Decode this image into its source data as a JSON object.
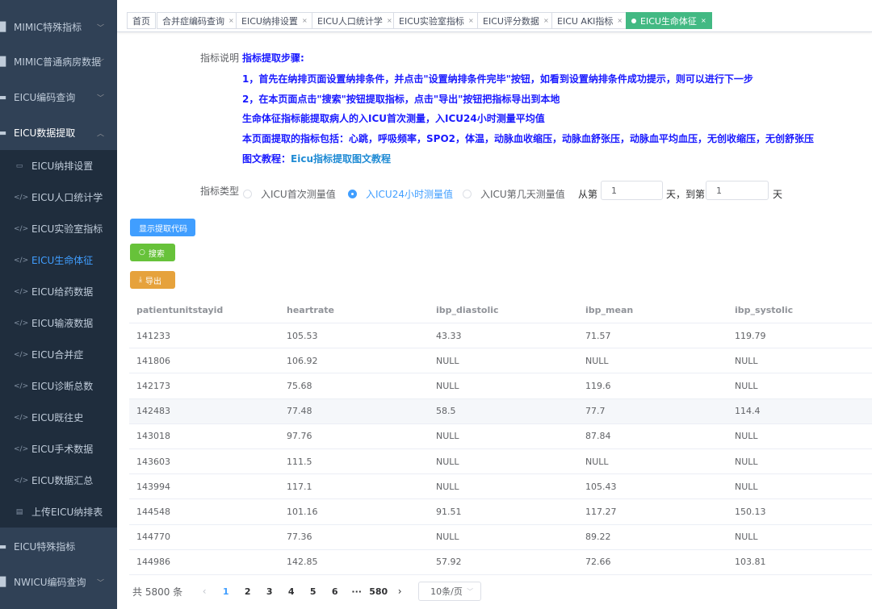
{
  "sidebar": {
    "menus": [
      {
        "label": "MIMIC特殊指标",
        "icon": "bar-chart-icon"
      },
      {
        "label": "MIMIC普通病房数据",
        "icon": "bar-chart-icon"
      },
      {
        "label": "EICU编码查询",
        "icon": "folder-icon"
      },
      {
        "label": "EICU数据提取",
        "icon": "folder-icon"
      }
    ],
    "sub_items": [
      {
        "label": "EICU纳排设置",
        "icon": "monitor-icon"
      },
      {
        "label": "EICU人口统计学",
        "icon": "code-icon"
      },
      {
        "label": "EICU实验室指标",
        "icon": "code-icon"
      },
      {
        "label": "EICU生命体征",
        "icon": "code-icon"
      },
      {
        "label": "EICU给药数据",
        "icon": "code-icon"
      },
      {
        "label": "EICU输液数据",
        "icon": "code-icon"
      },
      {
        "label": "EICU合并症",
        "icon": "code-icon"
      },
      {
        "label": "EICU诊断总数",
        "icon": "code-icon"
      },
      {
        "label": "EICU既往史",
        "icon": "code-icon"
      },
      {
        "label": "EICU手术数据",
        "icon": "code-icon"
      },
      {
        "label": "EICU数据汇总",
        "icon": "code-icon"
      },
      {
        "label": "上传EICU纳排表",
        "icon": "table-icon"
      }
    ],
    "bottom_menus": [
      {
        "label": "EICU特殊指标",
        "icon": "folder-icon"
      },
      {
        "label": "NWICU编码查询",
        "icon": "bar-chart-icon"
      }
    ],
    "active_sub": "EICU生命体征"
  },
  "tags": [
    {
      "label": "首页"
    },
    {
      "label": "合并症编码查询"
    },
    {
      "label": "EICU纳排设置"
    },
    {
      "label": "EICU人口统计学"
    },
    {
      "label": "EICU实验室指标"
    },
    {
      "label": "EICU评分数据"
    },
    {
      "label": "EICU AKI指标"
    },
    {
      "label": "EICU生命体征"
    }
  ],
  "description": {
    "label": "指标说明",
    "heading": "指标提取步骤:",
    "step1": "1，首先在纳排页面设置纳排条件，并点击\"设置纳排条件完毕\"按钮，如看到设置纳排条件成功提示，则可以进行下一步",
    "step2": "2，在本页面点击\"搜索\"按钮提取指标，点击\"导出\"按钮把指标导出到本地",
    "note": "生命体征指标能提取病人的入ICU首次测量，入ICU24小时测量平均值",
    "includes": "本页面提取的指标包括：心跳，呼吸频率，SPO2，体温，动脉血收缩压，动脉血舒张压，动脉血平均血压，无创收缩压，无创舒张压",
    "tutorial_prefix": "图文教程：",
    "tutorial_link": "Eicu指标提取图文教程"
  },
  "type_row": {
    "label": "指标类型",
    "options": [
      "入ICU首次测量值",
      "入ICU24小时测量值",
      "入ICU第几天测量值"
    ],
    "selected": "入ICU24小时测量值",
    "from_label": "从第",
    "from_value": "1",
    "day_to_label": "天，到第",
    "to_value": "1",
    "day_label": "天"
  },
  "buttons": {
    "show_code": "显示提取代码",
    "search": "搜索",
    "export": "导出"
  },
  "table": {
    "columns": [
      "patientunitstayid",
      "heartrate",
      "ibp_diastolic",
      "ibp_mean",
      "ibp_systolic"
    ],
    "rows": [
      [
        "141233",
        "105.53",
        "43.33",
        "71.57",
        "119.79"
      ],
      [
        "141806",
        "106.92",
        "NULL",
        "NULL",
        "NULL"
      ],
      [
        "142173",
        "75.68",
        "NULL",
        "119.6",
        "NULL"
      ],
      [
        "142483",
        "77.48",
        "58.5",
        "77.7",
        "114.4"
      ],
      [
        "143018",
        "97.76",
        "NULL",
        "87.84",
        "NULL"
      ],
      [
        "143603",
        "111.5",
        "NULL",
        "NULL",
        "NULL"
      ],
      [
        "143994",
        "117.1",
        "NULL",
        "105.43",
        "NULL"
      ],
      [
        "144548",
        "101.16",
        "91.51",
        "117.27",
        "150.13"
      ],
      [
        "144770",
        "77.36",
        "NULL",
        "89.22",
        "NULL"
      ],
      [
        "144986",
        "142.85",
        "57.92",
        "72.66",
        "103.81"
      ]
    ]
  },
  "pagination": {
    "total": "共 5800 条",
    "pages": [
      "1",
      "2",
      "3",
      "4",
      "5",
      "6",
      "···",
      "580"
    ],
    "current": "1",
    "page_size": "10条/页"
  }
}
